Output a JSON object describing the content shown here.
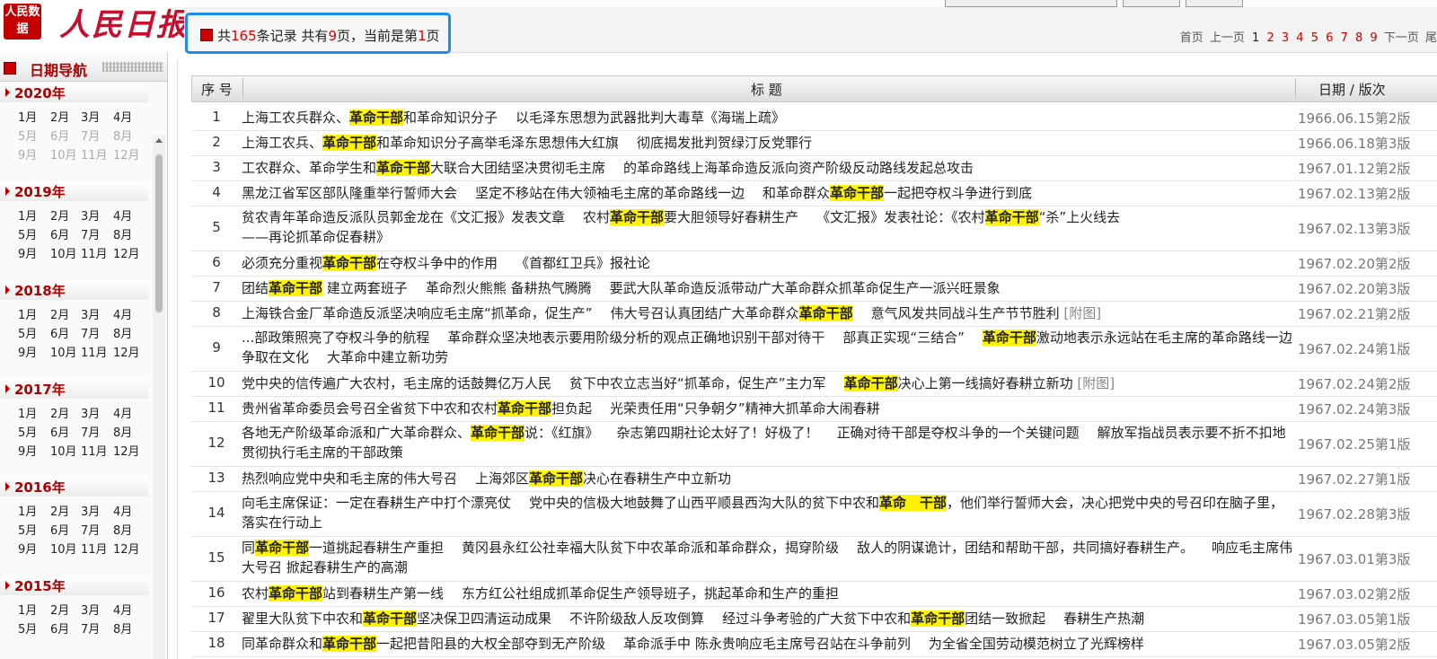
{
  "header": {
    "logo_text": "人民日报",
    "logo_seal": "人民数据",
    "record_info": {
      "prefix": "共",
      "total": "165",
      "mid1": "条记录 共有",
      "pages": "9",
      "mid2": "页，当前是第",
      "current": "1",
      "suffix": "页"
    }
  },
  "pager": {
    "first": "首页",
    "prev": "上一页",
    "pages": [
      "1",
      "2",
      "3",
      "4",
      "5",
      "6",
      "7",
      "8",
      "9"
    ],
    "next": "下一页",
    "last": "尾"
  },
  "sidebar": {
    "title": "日期导航",
    "years": [
      {
        "year": "2020年",
        "months": [
          "1月",
          "2月",
          "3月",
          "4月",
          "5月",
          "6月",
          "7月",
          "8月",
          "9月",
          "10月",
          "11月",
          "12月"
        ],
        "dim_from": 4
      },
      {
        "year": "2019年",
        "months": [
          "1月",
          "2月",
          "3月",
          "4月",
          "5月",
          "6月",
          "7月",
          "8月",
          "9月",
          "10月",
          "11月",
          "12月"
        ],
        "dim_from": 12
      },
      {
        "year": "2018年",
        "months": [
          "1月",
          "2月",
          "3月",
          "4月",
          "5月",
          "6月",
          "7月",
          "8月",
          "9月",
          "10月",
          "11月",
          "12月"
        ],
        "dim_from": 12
      },
      {
        "year": "2017年",
        "months": [
          "1月",
          "2月",
          "3月",
          "4月",
          "5月",
          "6月",
          "7月",
          "8月",
          "9月",
          "10月",
          "11月",
          "12月"
        ],
        "dim_from": 12
      },
      {
        "year": "2016年",
        "months": [
          "1月",
          "2月",
          "3月",
          "4月",
          "5月",
          "6月",
          "7月",
          "8月",
          "9月",
          "10月",
          "11月",
          "12月"
        ],
        "dim_from": 12
      },
      {
        "year": "2015年",
        "months": [
          "1月",
          "2月",
          "3月",
          "4月",
          "5月",
          "6月",
          "7月",
          "8月"
        ],
        "dim_from": 12
      }
    ]
  },
  "table": {
    "headers": {
      "num": "序 号",
      "title": "标 题",
      "date": "日期 / 版次"
    },
    "rows": [
      {
        "num": "1",
        "date": "1966.06.15第2版",
        "items": [
          "上海工农兵群众、[[革命干部]]和革命知识分子",
          "以毛泽东思想为武器批判大毒草《海瑞上疏》"
        ]
      },
      {
        "num": "2",
        "date": "1966.06.18第3版",
        "items": [
          "上海工农兵、[[革命干部]]和革命知识分子高举毛泽东思想伟大红旗",
          "彻底揭发批判贺绿汀反党罪行"
        ]
      },
      {
        "num": "3",
        "date": "1967.01.12第2版",
        "items": [
          "工农群众、革命学生和[[革命干部]]大联合大团结坚决贯彻毛主席",
          "的革命路线上海革命造反派向资产阶级反动路线发起总攻击"
        ]
      },
      {
        "num": "4",
        "date": "1967.02.13第2版",
        "items": [
          "黑龙江省军区部队隆重举行誓师大会",
          "坚定不移站在伟大领袖毛主席的革命路线一边",
          "和革命群众[[革命干部]]一起把夺权斗争进行到底"
        ]
      },
      {
        "num": "5",
        "date": "1967.02.13第3版",
        "items": [
          "贫农青年革命造反派队员郭金龙在《文汇报》发表文章",
          "农村[[革命干部]]要大胆领导好春耕生产",
          "《文汇报》发表社论：《农村[[革命干部]]“杀”上火线去",
          "——再论抓革命促春耕》"
        ]
      },
      {
        "num": "6",
        "date": "1967.02.20第2版",
        "items": [
          "必须充分重视[[革命干部]]在夺权斗争中的作用",
          "《首都红卫兵》报社论"
        ]
      },
      {
        "num": "7",
        "date": "1967.02.20第3版",
        "items": [
          "团结[[革命干部]] 建立两套班子",
          "革命烈火熊熊 备耕热气腾腾",
          "要武大队革命造反派带动广大革命群众抓革命促生产一派兴旺景象"
        ]
      },
      {
        "num": "8",
        "date": "1967.02.21第2版",
        "items": [
          "上海铁合金厂革命造反派坚决响应毛主席“抓革命，促生产”",
          "伟大号召认真团结广大革命群众[[革命干部]]",
          "意气风发共同战斗生产节节胜利 {{[附图]}}"
        ]
      },
      {
        "num": "9",
        "date": "1967.02.24第1版",
        "items": [
          "...部政策照亮了夺权斗争的航程",
          "革命群众坚决地表示要用阶级分析的观点正确地识别干部对待干",
          "部真正实现“三结合”",
          "[[革命干部]]激动地表示永远站在毛主席的革命路线一边争取在文化",
          "大革命中建立新功劳"
        ]
      },
      {
        "num": "10",
        "date": "1967.02.24第2版",
        "items": [
          "党中央的信传遍广大农村，毛主席的话鼓舞亿万人民",
          "贫下中农立志当好“抓革命，促生产”主力军",
          "[[革命干部]]决心上第一线搞好春耕立新功 {{[附图]}}"
        ]
      },
      {
        "num": "11",
        "date": "1967.02.24第3版",
        "items": [
          "贵州省革命委员会号召全省贫下中农和农村[[革命干部]]担负起",
          "光荣责任用“只争朝夕”精神大抓革命大闹春耕"
        ]
      },
      {
        "num": "12",
        "date": "1967.02.25第1版",
        "items": [
          "各地无产阶级革命派和广大革命群众、[[革命干部]]说：《红旗》",
          "杂志第四期社论太好了！好极了！",
          "正确对待干部是夺权斗争的一个关键问题",
          "解放军指战员表示要不折不扣地贯彻执行毛主席的干部政策"
        ]
      },
      {
        "num": "13",
        "date": "1967.02.27第1版",
        "items": [
          "热烈响应党中央和毛主席的伟大号召",
          "上海郊区[[革命干部]]决心在春耕生产中立新功"
        ]
      },
      {
        "num": "14",
        "date": "1967.02.28第3版",
        "items": [
          "向毛主席保证：一定在春耕生产中打个漂亮仗",
          "党中央的信极大地鼓舞了山西平顺县西沟大队的贫下中农和[[革命　干部]]，他们举行誓师大会，决心把党中央的号召印在脑子里，落实在行动上"
        ]
      },
      {
        "num": "15",
        "date": "1967.03.01第3版",
        "items": [
          "同[[革命干部]]一道挑起春耕生产重担",
          "黄冈县永红公社幸福大队贫下中农革命派和革命群众，揭穿阶级",
          "敌人的阴谋诡计，团结和帮助干部，共同搞好春耕生产。",
          "响应毛主席伟大号召 掀起春耕生产的高潮"
        ]
      },
      {
        "num": "16",
        "date": "1967.03.02第2版",
        "items": [
          "农村[[革命干部]]站到春耕生产第一线",
          "东方红公社组成抓革命促生产领导班子，挑起革命和生产的重担"
        ]
      },
      {
        "num": "17",
        "date": "1967.03.05第1版",
        "items": [
          "翟里大队贫下中农和[[革命干部]]坚决保卫四清运动成果",
          "不许阶级敌人反攻倒算",
          "经过斗争考验的广大贫下中农和[[革命干部]]团结一致掀起",
          "春耕生产热潮"
        ]
      },
      {
        "num": "18",
        "date": "1967.03.05第2版",
        "items": [
          "同革命群众和[[革命干部]]一起把昔阳县的大权全部夺到无产阶级",
          "革命派手中 陈永贵响应毛主席号召站在斗争前列",
          "为全省全国劳动模范树立了光辉榜样"
        ]
      }
    ]
  },
  "colors": {
    "accent": "#c00000",
    "highlight": "#fff200",
    "focus_box": "#1b8cf2"
  }
}
